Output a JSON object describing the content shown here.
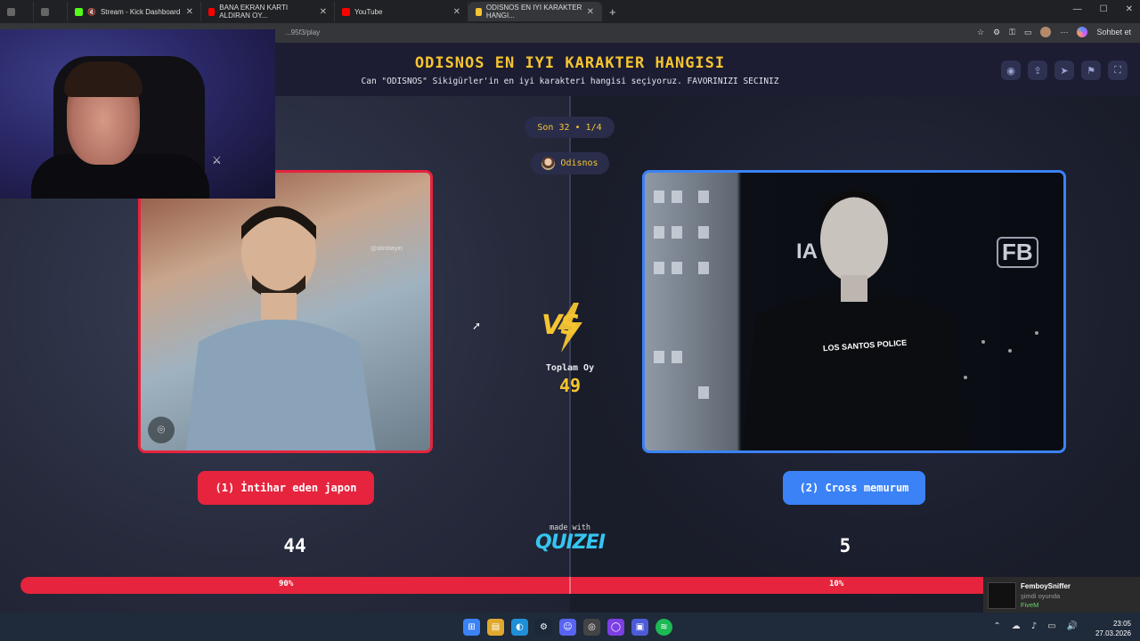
{
  "browser": {
    "tabs": [
      {
        "label": "",
        "icon": "generic-tab-icon",
        "active": false
      },
      {
        "label": "",
        "icon": "generic-tab-icon",
        "active": false
      },
      {
        "label": "Stream - Kick Dashboard",
        "icon": "kick-icon",
        "active": false
      },
      {
        "label": "BANA EKRAN KARTI ALDIRAN OY...",
        "icon": "youtube-icon",
        "active": false
      },
      {
        "label": "YouTube",
        "icon": "youtube-icon",
        "active": false
      },
      {
        "label": "ODISNOS EN IYI KARAKTER HANGI...",
        "icon": "quiz-icon",
        "active": true
      }
    ],
    "url_tail": "...95f3/play",
    "right_label": "Sohbet et"
  },
  "page": {
    "title": "ODISNOS EN IYI KARAKTER HANGISI",
    "subtitle": "Can \"ODISNOS\" Sikigürler'in en iyi karakteri hangisi seçiyoruz. FAVORINIZI SECINIZ",
    "round": "Son 32 • 1/4",
    "author": "Odisnos",
    "vs": "VS",
    "total_label": "Toplam Oy",
    "total_value": "49",
    "made_with": "made with",
    "brand": "QUIZEI"
  },
  "left": {
    "label": "(1) İntihar eden japon",
    "votes": "44",
    "percent_label": "90%",
    "watermark": "@alintilayin",
    "color": "#e6243d"
  },
  "right": {
    "label": "(2) Cross memurum",
    "votes": "5",
    "percent_label": "10%",
    "police": "LOS SANTOS POLICE",
    "sign_a": "IA",
    "sign_b": "FB",
    "color": "#3b82f6"
  },
  "progress": {
    "left_fraction": 0.9
  },
  "notification": {
    "name": "FemboySniffer",
    "status": "şimdi oyunda",
    "game": "FiveM"
  },
  "taskbar": {
    "time": "23:05",
    "date": "27.03.2026"
  },
  "colors": {
    "accent": "#f5c431",
    "brand": "#35c5f0"
  }
}
